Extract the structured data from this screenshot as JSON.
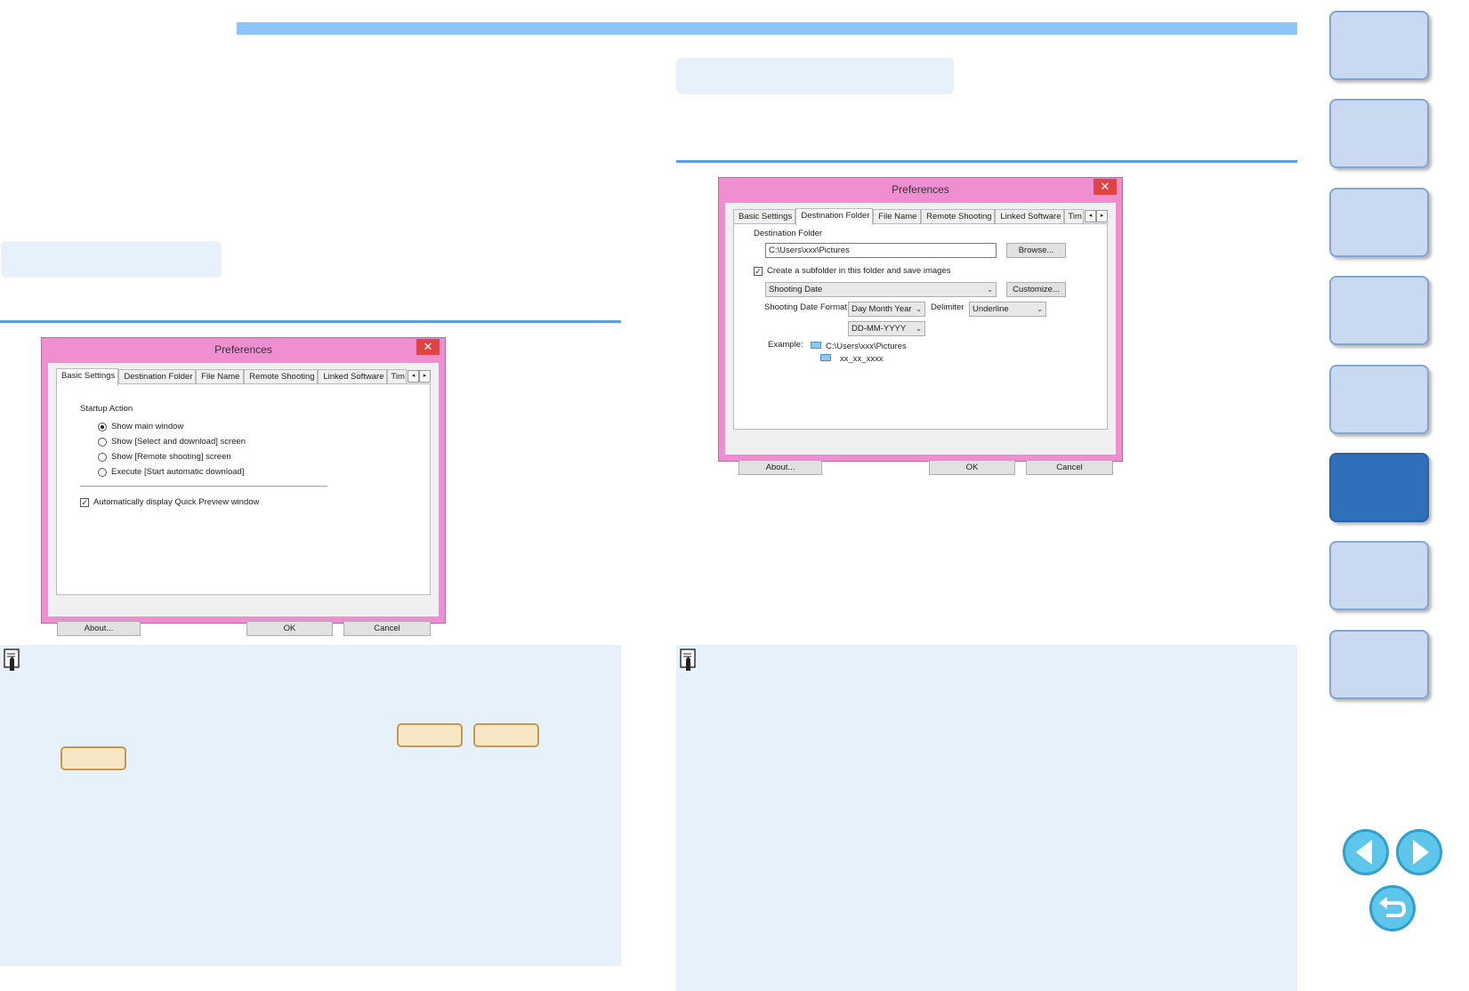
{
  "left_dialog": {
    "title": "Preferences",
    "close": "✕",
    "tabs": [
      "Basic Settings",
      "Destination Folder",
      "File Name",
      "Remote Shooting",
      "Linked Software",
      "Tim"
    ],
    "group_label": "Startup Action",
    "options": [
      {
        "label": "Show main window",
        "selected": true
      },
      {
        "label": "Show [Select and download] screen",
        "selected": false
      },
      {
        "label": "Show [Remote shooting] screen",
        "selected": false
      },
      {
        "label": "Execute [Start automatic download]",
        "selected": false
      }
    ],
    "checkbox_label": "Automatically display Quick Preview window",
    "checkbox_checked": true,
    "about": "About...",
    "ok": "OK",
    "cancel": "Cancel"
  },
  "right_dialog": {
    "title": "Preferences",
    "close": "✕",
    "tabs": [
      "Basic Settings",
      "Destination Folder",
      "File Name",
      "Remote Shooting",
      "Linked Software",
      "Tim"
    ],
    "dest_label": "Destination Folder",
    "dest_path": "C:\\Users\\xxx\\Pictures",
    "browse": "Browse...",
    "subfolder_label": "Create a subfolder in this folder and save images",
    "subfolder_checked": true,
    "subfolder_type": "Shooting Date",
    "customize": "Customize...",
    "date_format_label": "Shooting Date Format",
    "date_format": "Day Month Year",
    "delimiter_label": "Delimiter",
    "delimiter": "Underline",
    "date_pattern": "DD-MM-YYYY",
    "example_label": "Example:",
    "example_path": "C:\\Users\\xxx\\Pictures",
    "example_sub": "xx_xx_xxxx",
    "about": "About...",
    "ok": "OK",
    "cancel": "Cancel"
  },
  "arrows": {
    "left": "◂",
    "right": "▸",
    "dropdown": "⌄"
  },
  "icons": {
    "prev": "prev-page-icon",
    "next": "next-page-icon",
    "back": "return-icon",
    "note": "memo-icon"
  }
}
